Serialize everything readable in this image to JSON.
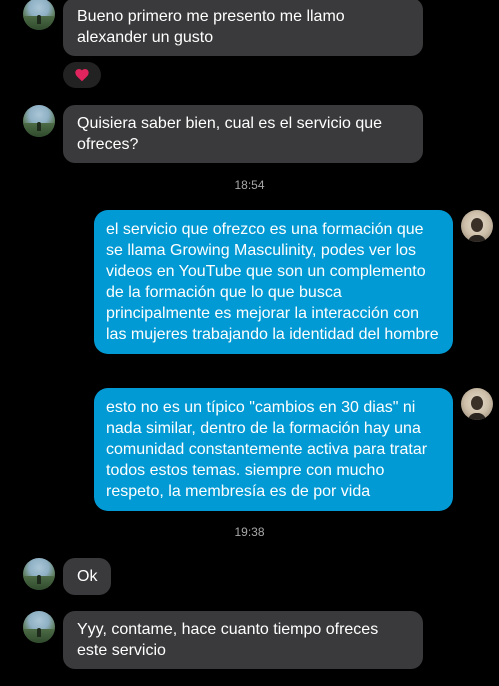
{
  "conversation": {
    "messages": [
      {
        "direction": "in",
        "text": "Bueno primero me presento me llamo alexander un gusto"
      },
      {
        "direction": "in",
        "text": "Quisiera saber bien, cual es el servicio que ofreces?"
      },
      {
        "direction": "out",
        "text": "el servicio que ofrezco es una formación que se llama Growing Masculinity, podes ver los videos en YouTube que son un complemento de la formación que lo que busca principalmente es mejorar la interacción con las mujeres trabajando la identidad del hombre"
      },
      {
        "direction": "out",
        "text": "esto no es un típico \"cambios en 30 dias\" ni nada similar, dentro de la formación hay una comunidad constantemente activa para tratar todos estos temas. siempre con mucho respeto, la membresía es de por vida"
      },
      {
        "direction": "in",
        "text": "Ok"
      },
      {
        "direction": "in",
        "text": "Yyy, contame, hace cuanto tiempo ofreces este servicio"
      }
    ],
    "timestamps": [
      "18:54",
      "19:38"
    ],
    "reaction": {
      "icon": "heart-icon",
      "color": "#e0245e"
    }
  },
  "colors": {
    "background": "#000000",
    "incoming_bubble": "#3a3a3c",
    "outgoing_bubble": "#029ad4",
    "timestamp": "#a8a8a8"
  }
}
